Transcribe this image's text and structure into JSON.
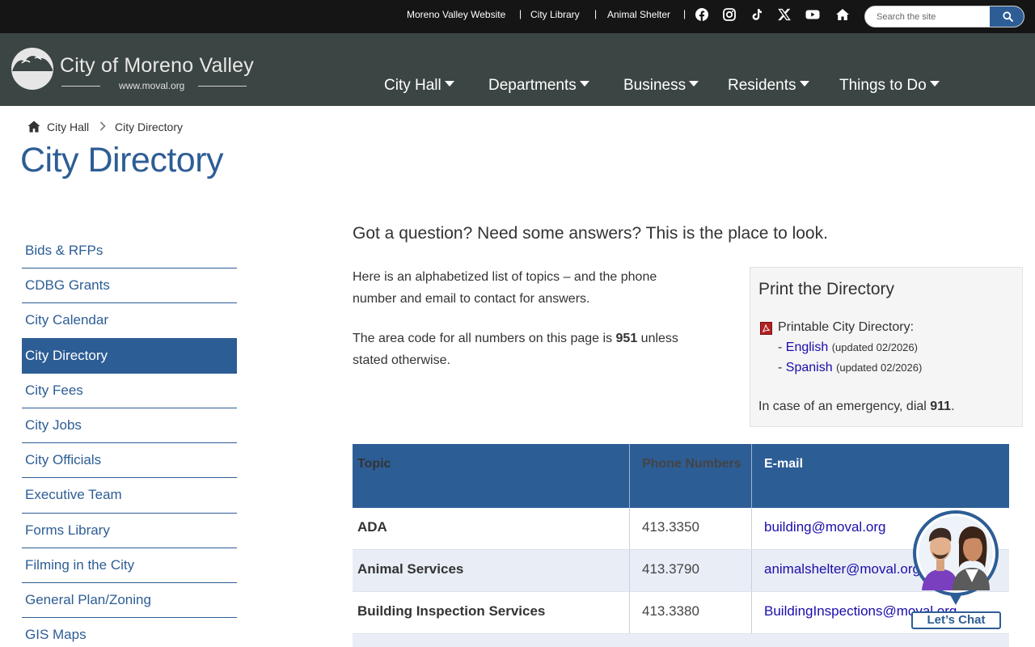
{
  "utility_bar": {
    "links": [
      "Moreno Valley Website",
      "City Library",
      "Animal Shelter"
    ],
    "social_icons": [
      "facebook-icon",
      "instagram-icon",
      "tiktok-icon",
      "x-icon",
      "youtube-icon",
      "home-icon"
    ],
    "search_placeholder": "Search the site"
  },
  "header": {
    "logo_title": "City of Moreno Valley",
    "logo_url": "www.moval.org",
    "nav": [
      "City Hall",
      "Departments",
      "Business",
      "Residents",
      "Things to Do"
    ]
  },
  "breadcrumb": [
    "City Hall",
    "City Directory"
  ],
  "page_title": "City Directory",
  "sidebar": {
    "items": [
      "Bids & RFPs",
      "CDBG Grants",
      "City Calendar",
      "City Directory",
      "City Fees",
      "City Jobs",
      "City Officials",
      "Executive Team",
      "Forms Library",
      "Filming in the City",
      "General Plan/Zoning",
      "GIS Maps"
    ],
    "active": "City Directory"
  },
  "main": {
    "lead": "Got a question? Need some answers? This is the place to look.",
    "intro": "Here is an alphabetized list of topics – and the phone number and email to contact for answers.",
    "area_code_prefix": "The area code for all numbers on this page is ",
    "area_code": "951",
    "area_code_suffix": " unless stated otherwise."
  },
  "print_box": {
    "title": "Print the Directory",
    "label": "Printable City Directory:",
    "links": [
      {
        "prefix": "- ",
        "text": "English",
        "note": "(updated 02/2026)"
      },
      {
        "prefix": "- ",
        "text": "Spanish",
        "note": "(updated 02/2026)"
      }
    ],
    "emergency_prefix": "In case of an emergency, dial ",
    "emergency_number": "911",
    "emergency_suffix": "."
  },
  "table": {
    "headers": [
      "Topic",
      "Phone Numbers",
      "E-mail"
    ],
    "rows": [
      {
        "topic": "ADA",
        "phone": "413.3350",
        "email": "building@moval.org"
      },
      {
        "topic": "Animal Services",
        "phone": "413.3790",
        "email": "animalshelter@moval.org"
      },
      {
        "topic": "Building Inspection Services",
        "phone": "413.3380",
        "email": "BuildingInspections@moval.org"
      }
    ]
  },
  "chat": {
    "label": "Let’s Chat"
  },
  "colors": {
    "accent": "#2d5d95",
    "header_bg": "#3b4543",
    "topbar_bg": "#151515",
    "link": "#1a0dab"
  }
}
